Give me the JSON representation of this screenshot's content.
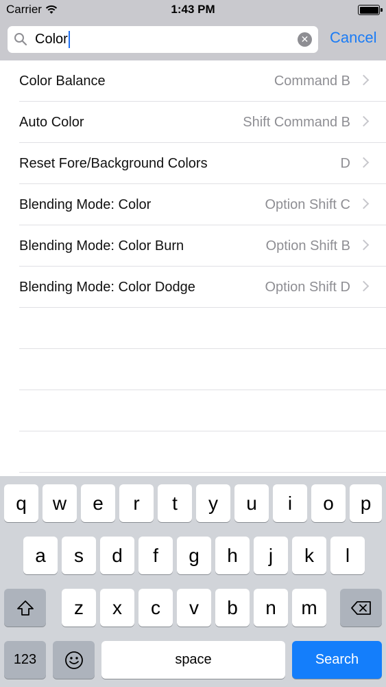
{
  "status_bar": {
    "carrier": "Carrier",
    "time": "1:43 PM",
    "icons": [
      "wifi-icon",
      "battery-icon"
    ]
  },
  "search": {
    "value": "Color",
    "cancel_label": "Cancel"
  },
  "results": [
    {
      "title": "Color Balance",
      "shortcut": "Command B"
    },
    {
      "title": "Auto Color",
      "shortcut": "Shift Command B"
    },
    {
      "title": "Reset Fore/Background Colors",
      "shortcut": "D"
    },
    {
      "title": "Blending Mode: Color",
      "shortcut": "Option Shift C"
    },
    {
      "title": "Blending Mode: Color Burn",
      "shortcut": "Option Shift B"
    },
    {
      "title": "Blending Mode: Color Dodge",
      "shortcut": "Option Shift D"
    }
  ],
  "keyboard": {
    "row1": [
      "q",
      "w",
      "e",
      "r",
      "t",
      "y",
      "u",
      "i",
      "o",
      "p"
    ],
    "row2": [
      "a",
      "s",
      "d",
      "f",
      "g",
      "h",
      "j",
      "k",
      "l"
    ],
    "row3": [
      "z",
      "x",
      "c",
      "v",
      "b",
      "n",
      "m"
    ],
    "numbers_label": "123",
    "space_label": "space",
    "search_label": "Search",
    "icons": [
      "shift-icon",
      "backspace-icon",
      "emoji-icon"
    ]
  },
  "colors": {
    "accent": "#1a7bf5",
    "search_key": "#147efb",
    "bar_background": "#c9c9ce",
    "keyboard_background": "#d1d4d9"
  }
}
